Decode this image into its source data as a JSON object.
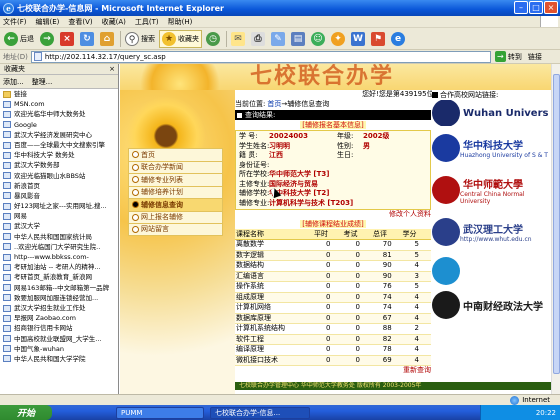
{
  "window": {
    "title": "七校联合办学-信息网 - Microsoft Internet Explorer",
    "close_label": "×"
  },
  "menu": [
    "文件(F)",
    "编辑(E)",
    "查看(V)",
    "收藏(A)",
    "工具(T)",
    "帮助(H)"
  ],
  "toolbar": {
    "back_label": "后退",
    "search_label": "搜索",
    "favorites_label": "收藏夹"
  },
  "address": {
    "label": "地址(D)",
    "url": "http://202.114.32.17/query_sc.asp",
    "go_label": "转到",
    "links_label": "链接"
  },
  "favorites": {
    "title": "收藏夹",
    "add_label": "添加...",
    "organize_label": "整理...",
    "items": [
      {
        "label": "链接",
        "kind": "folder"
      },
      {
        "label": "MSN.com",
        "kind": "page"
      },
      {
        "label": "欢迎光临华中师大数务处",
        "kind": "page"
      },
      {
        "label": "Google",
        "kind": "page"
      },
      {
        "label": "武汉大学经济发展研究中心",
        "kind": "page"
      },
      {
        "label": "百度——全球最大中文搜索引擎",
        "kind": "page"
      },
      {
        "label": "华中科技大学 数务处",
        "kind": "page"
      },
      {
        "label": "武汉大学数务部",
        "kind": "page"
      },
      {
        "label": "欢迎光临猫眼山水BBS站",
        "kind": "page"
      },
      {
        "label": "新浪首页",
        "kind": "page"
      },
      {
        "label": "暴风影音",
        "kind": "page"
      },
      {
        "label": "好123网址之家---实用网址,搜...",
        "kind": "page"
      },
      {
        "label": "网易",
        "kind": "page"
      },
      {
        "label": "武汉大学",
        "kind": "page"
      },
      {
        "label": "中华人民共和国国家统计局",
        "kind": "page"
      },
      {
        "label": "..欢迎光临国门大学研究生院..",
        "kind": "page"
      },
      {
        "label": "http---www.bbkss.com-",
        "kind": "page"
      },
      {
        "label": "考研加油站 -- 考研人的精神...",
        "kind": "page"
      },
      {
        "label": "考研首页_新浪教育_新浪网",
        "kind": "page"
      },
      {
        "label": "网易163邮箱--中文邮箱第一品牌",
        "kind": "page"
      },
      {
        "label": "致要加服网加服连锁经营加...",
        "kind": "page"
      },
      {
        "label": "武汉大学招生就业工作处",
        "kind": "page"
      },
      {
        "label": "早报网 Zaobao.com",
        "kind": "page"
      },
      {
        "label": "招商银行信用卡网站",
        "kind": "page"
      },
      {
        "label": "中国高校就业联盟网_大学生...",
        "kind": "page"
      },
      {
        "label": "中国气象-wuhan",
        "kind": "page"
      },
      {
        "label": "中华人民共和国大学学院",
        "kind": "page"
      }
    ]
  },
  "page": {
    "site_title": "七校联合办学",
    "welcome": "您好!您是第439195位访客。 今天是 2006年4月1日 星期六",
    "breadcrumb_prefix": "当前位置:",
    "breadcrumb_home": "首页",
    "breadcrumb_sep": "→",
    "breadcrumb_current": "辅修信息查询",
    "results_header": "查询结果:",
    "partners_header": "合作高校网站链接:",
    "info_title": "[辅修报名基本信息]",
    "info": {
      "sid_label": "学  号:",
      "sid": "20024003",
      "grade_label": "年级:",
      "grade": "2002级",
      "name_label": "学生姓名:",
      "name": "习明明",
      "gender_label": "性别:",
      "gender": "男",
      "origin_label": "籍    贯:",
      "origin": "江西",
      "birthday_label": "生日:",
      "birthday": "",
      "idcard_label": "身份证号:",
      "idcard": "",
      "school_label": "所在学校:",
      "school": "华中师范大学 [T3]",
      "major_label": "主修专业:",
      "major": "国际经济与贸易",
      "minor_school_label": "辅修学校:",
      "minor_school": "华中科技大学 [T2]",
      "minor_major_label": "辅修专业:",
      "minor_major": "计算机科学与技术 [T203]"
    },
    "modify_link": "修改个人资料",
    "grades_title": "[辅修课程结业成绩]",
    "grades_headers": [
      "课程名称",
      "平时",
      "考试",
      "总评",
      "学分"
    ],
    "grades": [
      [
        "离散数学",
        "0",
        "0",
        "70",
        "5"
      ],
      [
        "数字逻辑",
        "0",
        "0",
        "81",
        "5"
      ],
      [
        "数据结构",
        "0",
        "0",
        "90",
        "4"
      ],
      [
        "汇编语言",
        "0",
        "0",
        "90",
        "3"
      ],
      [
        "操作系统",
        "0",
        "0",
        "76",
        "5"
      ],
      [
        "组成原理",
        "0",
        "0",
        "74",
        "4"
      ],
      [
        "计算机网络",
        "0",
        "0",
        "74",
        "4"
      ],
      [
        "数据库原理",
        "0",
        "0",
        "67",
        "4"
      ],
      [
        "计算机系统结构",
        "0",
        "0",
        "88",
        "2"
      ],
      [
        "软件工程",
        "0",
        "0",
        "82",
        "4"
      ],
      [
        "编译原理",
        "0",
        "0",
        "78",
        "4"
      ],
      [
        "微机接口技术",
        "0",
        "0",
        "69",
        "4"
      ]
    ],
    "reselect_link": "重新查询",
    "footer": "七校联合办学管理中心 华中师范大学教务处 版权所有 2003-2005年",
    "nav": [
      {
        "label": "首页",
        "active": false
      },
      {
        "label": "联合办学新闻",
        "active": false
      },
      {
        "label": "辅修专业列表",
        "active": false
      },
      {
        "label": "辅修培养计划",
        "active": false
      },
      {
        "label": "辅修信息查询",
        "active": true
      },
      {
        "label": "网上报名辅修",
        "active": false
      },
      {
        "label": "网站留言",
        "active": false
      }
    ],
    "partners": [
      {
        "name": "Wuhan University",
        "sub": "",
        "color": "#1a2a6a"
      },
      {
        "name": "华中科技大学",
        "sub": "Huazhong University of S & T",
        "color": "#1a3aa0"
      },
      {
        "name": "华中师範大學",
        "sub": "Central China Normal University",
        "color": "#b01010"
      },
      {
        "name": "武汉理工大学",
        "sub": "http://www.whut.edu.cn",
        "color": "#2a3f8a"
      },
      {
        "name": "",
        "sub": "",
        "color": "#1d8fd0"
      },
      {
        "name": "中南财经政法大学",
        "sub": "",
        "color": "#1a1a1a"
      }
    ]
  },
  "status": {
    "zone": "Internet"
  },
  "taskbar": {
    "start_label": "开始",
    "tasks": [
      "PUMM",
      "七校联合办学-信息..."
    ],
    "clock": "20:22"
  }
}
